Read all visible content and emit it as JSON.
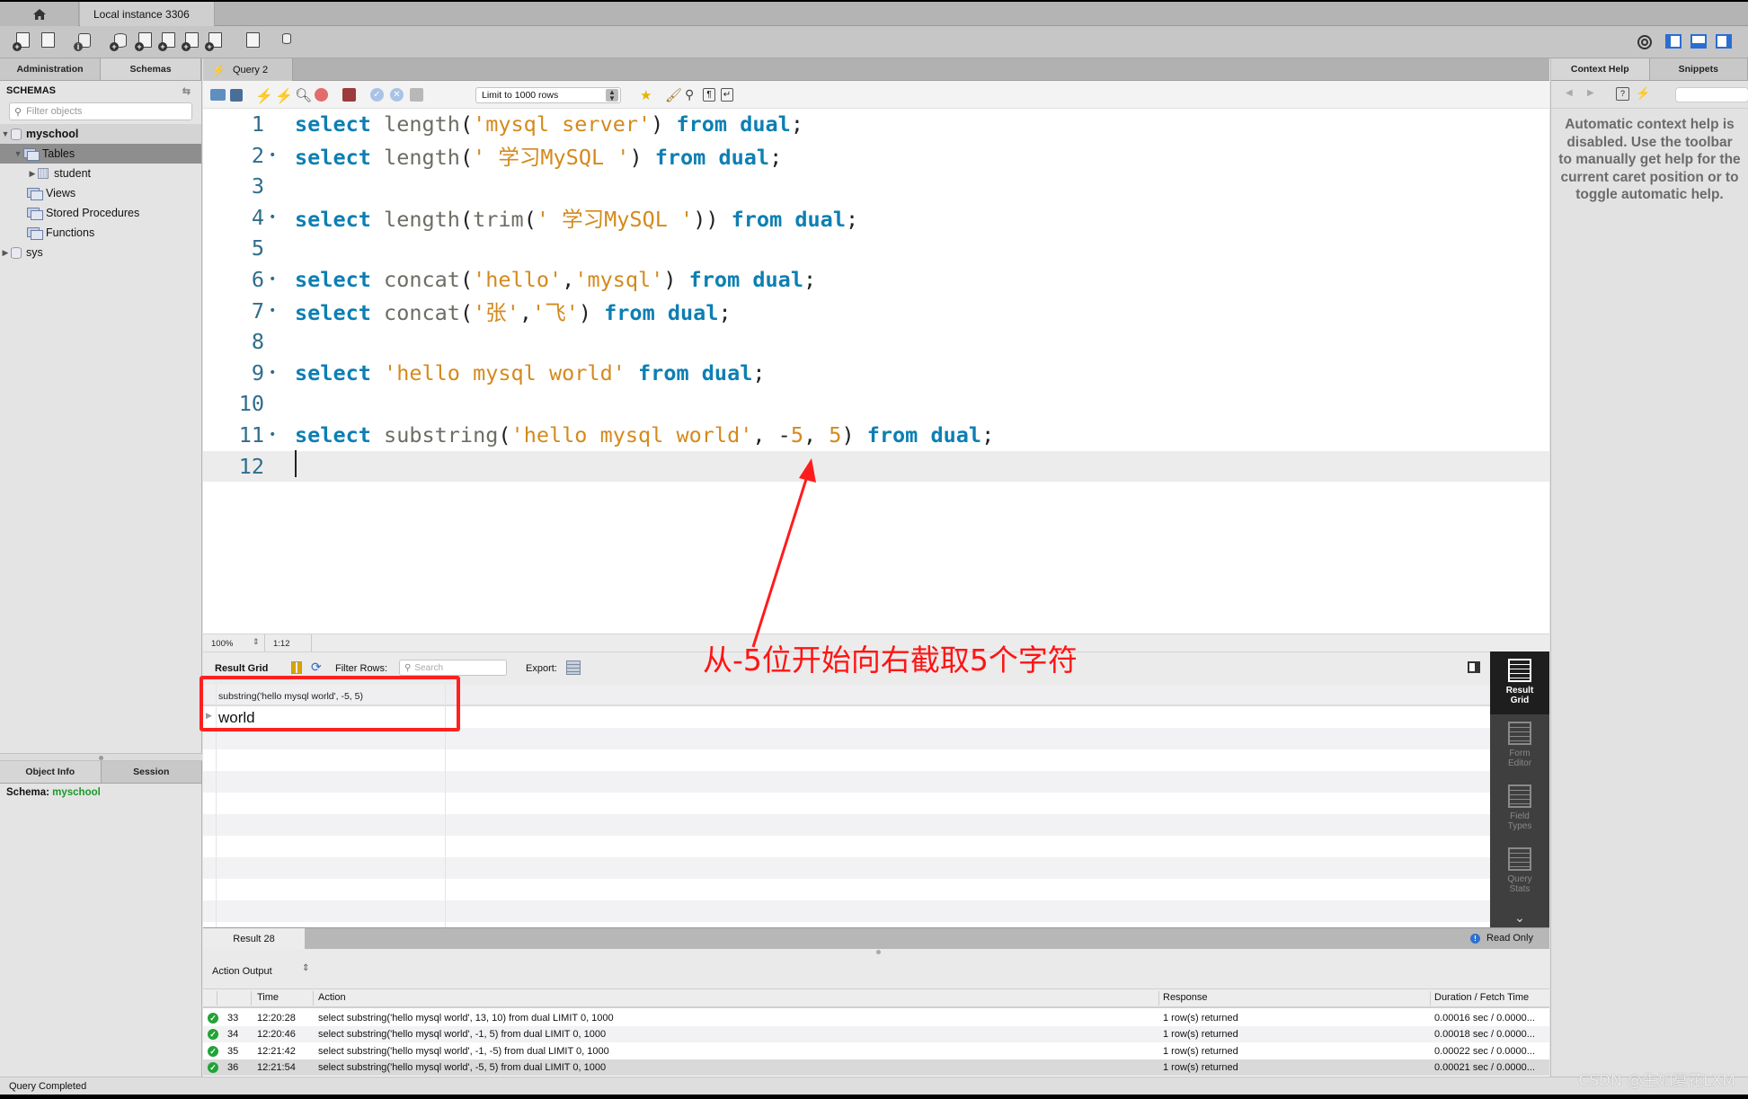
{
  "app": {
    "home_icon": "home-icon",
    "instance_tab": "Local instance 3306"
  },
  "toolbar": {
    "icons": [
      "new-sql-tab-icon",
      "open-sql-script-icon",
      "inspector-icon",
      "create-schema-icon",
      "create-table-icon",
      "create-view-icon",
      "create-procedure-icon",
      "create-function-icon",
      "search-table-data-icon",
      "reconnect-icon"
    ],
    "right_icons": [
      "settings-icon",
      "toggle-sidebar-icon",
      "toggle-output-icon",
      "toggle-secondary-sidebar-icon"
    ]
  },
  "sidebar": {
    "tabs": [
      "Administration",
      "Schemas"
    ],
    "active_tab": "Schemas",
    "header": "SCHEMAS",
    "filter_placeholder": "Filter objects",
    "tree": [
      {
        "label": "myschool",
        "level": 0,
        "expanded": true,
        "type": "schema"
      },
      {
        "label": "Tables",
        "level": 1,
        "expanded": true,
        "type": "folder",
        "selected": true
      },
      {
        "label": "student",
        "level": 2,
        "expanded": false,
        "type": "table"
      },
      {
        "label": "Views",
        "level": 1,
        "type": "folder"
      },
      {
        "label": "Stored Procedures",
        "level": 1,
        "type": "folder"
      },
      {
        "label": "Functions",
        "level": 1,
        "type": "folder"
      },
      {
        "label": "sys",
        "level": 0,
        "expanded": false,
        "type": "schema"
      }
    ],
    "info_tabs": [
      "Object Info",
      "Session"
    ],
    "schema_label": "Schema:",
    "schema_value": "myschool"
  },
  "query_tab": {
    "label": "Query 2"
  },
  "editor_toolbar": {
    "limit_select": "Limit to 1000 rows"
  },
  "editor": {
    "lines": [
      {
        "n": "1",
        "fold": "",
        "tokens": [
          [
            "kw",
            "select"
          ],
          [
            "pn",
            " "
          ],
          [
            "fn",
            "length"
          ],
          [
            "pn",
            "("
          ],
          [
            "str",
            "'mysql server'"
          ],
          [
            "pn",
            ") "
          ],
          [
            "kw",
            "from"
          ],
          [
            "pn",
            " "
          ],
          [
            "kw",
            "dual"
          ],
          [
            "pn",
            ";"
          ]
        ]
      },
      {
        "n": "2",
        "fold": "•",
        "tokens": [
          [
            "kw",
            "select"
          ],
          [
            "pn",
            " "
          ],
          [
            "fn",
            "length"
          ],
          [
            "pn",
            "("
          ],
          [
            "str",
            "' 学习MySQL '"
          ],
          [
            "pn",
            ") "
          ],
          [
            "kw",
            "from"
          ],
          [
            "pn",
            " "
          ],
          [
            "kw",
            "dual"
          ],
          [
            "pn",
            ";"
          ]
        ]
      },
      {
        "n": "3",
        "fold": "",
        "tokens": []
      },
      {
        "n": "4",
        "fold": "•",
        "tokens": [
          [
            "kw",
            "select"
          ],
          [
            "pn",
            " "
          ],
          [
            "fn",
            "length"
          ],
          [
            "pn",
            "("
          ],
          [
            "fn",
            "trim"
          ],
          [
            "pn",
            "("
          ],
          [
            "str",
            "' 学习MySQL '"
          ],
          [
            "pn",
            "))"
          ],
          [
            "pn",
            " "
          ],
          [
            "kw",
            "from"
          ],
          [
            "pn",
            " "
          ],
          [
            "kw",
            "dual"
          ],
          [
            "pn",
            ";"
          ]
        ]
      },
      {
        "n": "5",
        "fold": "",
        "tokens": []
      },
      {
        "n": "6",
        "fold": "•",
        "tokens": [
          [
            "kw",
            "select"
          ],
          [
            "pn",
            " "
          ],
          [
            "fn",
            "concat"
          ],
          [
            "pn",
            "("
          ],
          [
            "str",
            "'hello'"
          ],
          [
            "pn",
            ","
          ],
          [
            "str",
            "'mysql'"
          ],
          [
            "pn",
            ") "
          ],
          [
            "kw",
            "from"
          ],
          [
            "pn",
            " "
          ],
          [
            "kw",
            "dual"
          ],
          [
            "pn",
            ";"
          ]
        ]
      },
      {
        "n": "7",
        "fold": "•",
        "tokens": [
          [
            "kw",
            "select"
          ],
          [
            "pn",
            " "
          ],
          [
            "fn",
            "concat"
          ],
          [
            "pn",
            "("
          ],
          [
            "str",
            "'张'"
          ],
          [
            "pn",
            ","
          ],
          [
            "str",
            "'飞'"
          ],
          [
            "pn",
            ") "
          ],
          [
            "kw",
            "from"
          ],
          [
            "pn",
            " "
          ],
          [
            "kw",
            "dual"
          ],
          [
            "pn",
            ";"
          ]
        ]
      },
      {
        "n": "8",
        "fold": "",
        "tokens": []
      },
      {
        "n": "9",
        "fold": "•",
        "tokens": [
          [
            "kw",
            "select"
          ],
          [
            "pn",
            " "
          ],
          [
            "str",
            "'hello mysql world'"
          ],
          [
            "pn",
            " "
          ],
          [
            "kw",
            "from"
          ],
          [
            "pn",
            " "
          ],
          [
            "kw",
            "dual"
          ],
          [
            "pn",
            ";"
          ]
        ]
      },
      {
        "n": "10",
        "fold": "",
        "tokens": []
      },
      {
        "n": "11",
        "fold": "•",
        "tokens": [
          [
            "kw",
            "select"
          ],
          [
            "pn",
            " "
          ],
          [
            "fn",
            "substring"
          ],
          [
            "pn",
            "("
          ],
          [
            "str",
            "'hello mysql world'"
          ],
          [
            "pn",
            ", -"
          ],
          [
            "num",
            "5"
          ],
          [
            "pn",
            ", "
          ],
          [
            "num",
            "5"
          ],
          [
            "pn",
            ") "
          ],
          [
            "kw",
            "from"
          ],
          [
            "pn",
            " "
          ],
          [
            "kw",
            "dual"
          ],
          [
            "pn",
            ";"
          ]
        ]
      },
      {
        "n": "12",
        "fold": "",
        "tokens": [],
        "current": true
      }
    ],
    "zoom": "100%",
    "cursor_pos": "1:12"
  },
  "annotation": {
    "text": "从-5位开始向右截取5个字符",
    "color": "#ff1414"
  },
  "result": {
    "label": "Result Grid",
    "filter_label": "Filter Rows:",
    "search_placeholder": "Search",
    "export_label": "Export:",
    "columns": [
      "substring('hello mysql world', -5, 5)"
    ],
    "rows": [
      [
        "world"
      ]
    ],
    "side_tabs": [
      {
        "label": "Result\nGrid",
        "active": true
      },
      {
        "label": "Form\nEditor"
      },
      {
        "label": "Field\nTypes"
      },
      {
        "label": "Query\nStats"
      }
    ],
    "tab_label": "Result 28",
    "read_only": "Read Only"
  },
  "output": {
    "selector": "Action Output",
    "columns": [
      "",
      "Time",
      "Action",
      "Response",
      "Duration / Fetch Time"
    ],
    "rows": [
      {
        "status": "ok",
        "n": "33",
        "time": "12:20:28",
        "action": "select substring('hello mysql world', 13, 10) from dual LIMIT 0, 1000",
        "response": "1 row(s) returned",
        "duration": "0.00016 sec / 0.0000..."
      },
      {
        "status": "ok",
        "n": "34",
        "time": "12:20:46",
        "action": "select substring('hello mysql world', -1, 5) from dual LIMIT 0, 1000",
        "response": "1 row(s) returned",
        "duration": "0.00018 sec / 0.0000..."
      },
      {
        "status": "ok",
        "n": "35",
        "time": "12:21:42",
        "action": "select substring('hello mysql world', -1, -5) from dual LIMIT 0, 1000",
        "response": "1 row(s) returned",
        "duration": "0.00022 sec / 0.0000..."
      },
      {
        "status": "ok",
        "n": "36",
        "time": "12:21:54",
        "action": "select substring('hello mysql world', -5, 5) from dual LIMIT 0, 1000",
        "response": "1 row(s) returned",
        "duration": "0.00021 sec / 0.0000..."
      }
    ]
  },
  "right_pane": {
    "tabs": [
      "Context Help",
      "Snippets"
    ],
    "help_text": "Automatic context help is disabled. Use the toolbar to manually get help for the current caret position or to toggle automatic help."
  },
  "status": {
    "text": "Query Completed"
  },
  "watermark": "CSDN @生如夏花LXM"
}
